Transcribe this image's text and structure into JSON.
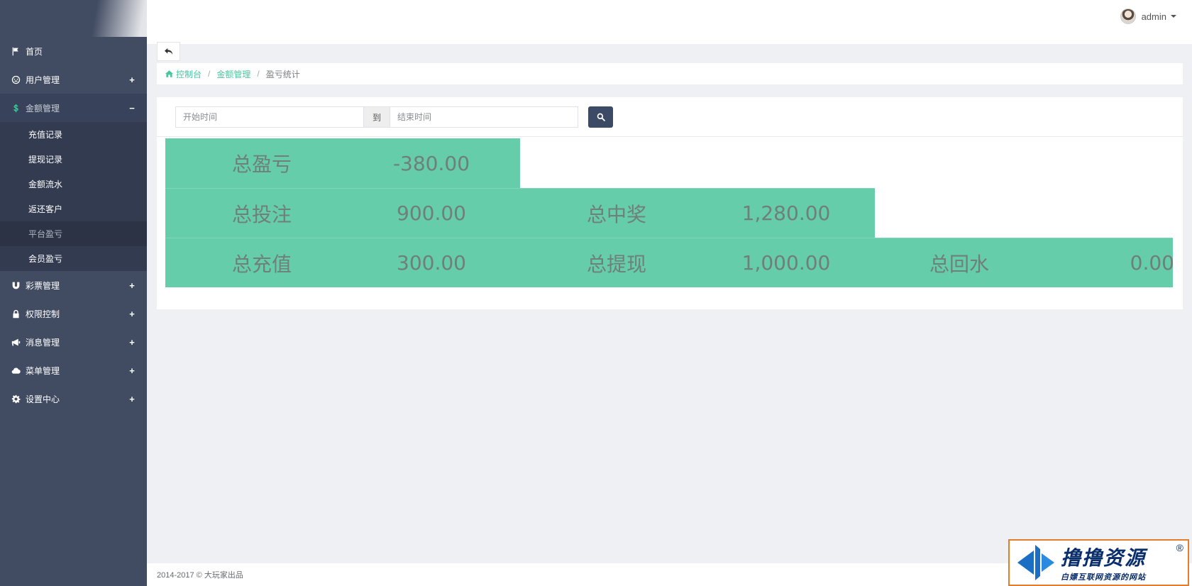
{
  "sidebar": {
    "items": [
      {
        "label": "首页",
        "icon": "flag-icon",
        "toggle": ""
      },
      {
        "label": "用户管理",
        "icon": "user-icon",
        "toggle": "+"
      },
      {
        "label": "金额管理",
        "icon": "dollar-icon",
        "toggle": "−",
        "children": [
          "充值记录",
          "提现记录",
          "金额流水",
          "返还客户",
          "平台盈亏",
          "会员盈亏"
        ]
      },
      {
        "label": "彩票管理",
        "icon": "magnet-icon",
        "toggle": "+"
      },
      {
        "label": "权限控制",
        "icon": "lock-icon",
        "toggle": "+"
      },
      {
        "label": "消息管理",
        "icon": "bullhorn-icon",
        "toggle": "+"
      },
      {
        "label": "菜单管理",
        "icon": "cloud-icon",
        "toggle": "+"
      },
      {
        "label": "设置中心",
        "icon": "gear-icon",
        "toggle": "+"
      }
    ],
    "active_child": "平台盈亏"
  },
  "header": {
    "username": "admin"
  },
  "breadcrumb": {
    "items": [
      "控制台",
      "金额管理",
      "盈亏统计"
    ]
  },
  "search": {
    "start_placeholder": "开始时间",
    "to_label": "到",
    "end_placeholder": "结束时间"
  },
  "stats": {
    "row1": [
      {
        "label": "总盈亏",
        "value": "-380.00"
      }
    ],
    "row2": [
      {
        "label": "总投注",
        "value": "900.00"
      },
      {
        "label": "总中奖",
        "value": "1,280.00"
      }
    ],
    "row3": [
      {
        "label": "总充值",
        "value": "300.00"
      },
      {
        "label": "总提现",
        "value": "1,000.00"
      },
      {
        "label": "总回水",
        "value": "0.00"
      }
    ]
  },
  "footer": {
    "text": "2014-2017 © 大玩家出品"
  },
  "watermark": {
    "title": "撸撸资源",
    "subtitle": "白嫖互联网资源的网站",
    "reg": "®"
  },
  "colors": {
    "sidebar_bg": "#414b62",
    "accent": "#4bc5a0",
    "stat_bg": "#66cdaa",
    "search_button": "#3c4a66"
  }
}
